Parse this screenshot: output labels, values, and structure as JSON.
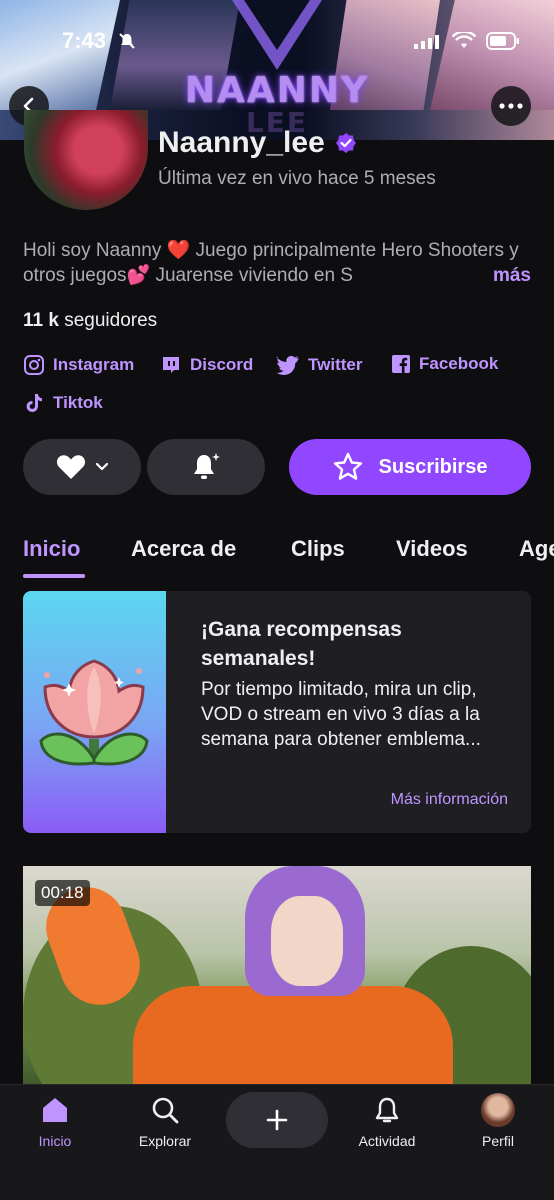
{
  "status_bar": {
    "time": "7:43"
  },
  "banner": {
    "title": "NAANNY",
    "subtitle": "LEE"
  },
  "profile": {
    "username": "Naanny_lee",
    "last_live": "Última vez en vivo hace 5 meses",
    "bio": "Holi soy Naanny ❤️ Juego principalmente Hero Shooters y otros juegos💕 Juarense viviendo en S",
    "bio_more": "más",
    "followers_count": "11 k",
    "followers_label": "seguidores"
  },
  "socials": [
    {
      "label": "Instagram",
      "icon": "instagram-icon"
    },
    {
      "label": "Discord",
      "icon": "discord-icon"
    },
    {
      "label": "Twitter",
      "icon": "twitter-icon"
    },
    {
      "label": "Facebook",
      "icon": "facebook-icon"
    },
    {
      "label": "Tiktok",
      "icon": "tiktok-icon"
    }
  ],
  "actions": {
    "subscribe_label": "Suscribirse"
  },
  "tabs": [
    {
      "label": "Inicio",
      "active": true
    },
    {
      "label": "Acerca de"
    },
    {
      "label": "Clips"
    },
    {
      "label": "Videos"
    },
    {
      "label": "Agenda"
    }
  ],
  "reward_card": {
    "title": "¡Gana recompensas semanales!",
    "description": "Por tiempo limitado, mira un clip, VOD o stream en vivo 3 días a la semana para obtener emblema...",
    "link": "Más información"
  },
  "clip": {
    "duration": "00:18"
  },
  "bottom_nav": [
    {
      "label": "Inicio",
      "icon": "home-icon",
      "active": true
    },
    {
      "label": "Explorar",
      "icon": "search-icon"
    },
    {
      "label": "Actividad",
      "icon": "bell-icon"
    },
    {
      "label": "Perfil",
      "icon": "profile-avatar"
    }
  ],
  "colors": {
    "accent": "#bf94ff",
    "primary_button": "#9147ff",
    "background": "#0e0e10"
  }
}
